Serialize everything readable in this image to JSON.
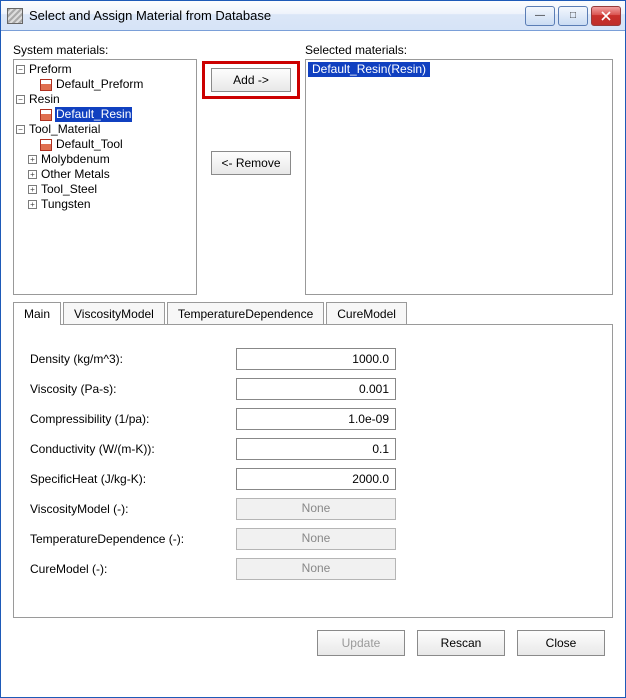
{
  "window": {
    "title": "Select and Assign Material from Database"
  },
  "labels": {
    "system_materials": "System materials:",
    "selected_materials": "Selected materials:",
    "add": "Add ->",
    "remove": "<- Remove",
    "update": "Update",
    "rescan": "Rescan",
    "close": "Close"
  },
  "tree": {
    "preform": "Preform",
    "default_preform": "Default_Preform",
    "resin": "Resin",
    "default_resin": "Default_Resin",
    "tool_material": "Tool_Material",
    "default_tool": "Default_Tool",
    "molybdenum": "Molybdenum",
    "other_metals": "Other Metals",
    "tool_steel": "Tool_Steel",
    "tungsten": "Tungsten"
  },
  "selected_list": {
    "item0": "Default_Resin(Resin)"
  },
  "tabs": {
    "main": "Main",
    "viscosity": "ViscosityModel",
    "tempdep": "TemperatureDependence",
    "curemodel": "CureModel"
  },
  "props": {
    "density_label": "Density (kg/m^3):",
    "density_value": "1000.0",
    "viscosity_label": "Viscosity (Pa-s):",
    "viscosity_value": "0.001",
    "compress_label": "Compressibility (1/pa):",
    "compress_value": "1.0e-09",
    "conduct_label": "Conductivity (W/(m-K)):",
    "conduct_value": "0.1",
    "specheat_label": "SpecificHeat (J/kg-K):",
    "specheat_value": "2000.0",
    "viscmodel_label": "ViscosityModel (-):",
    "viscmodel_value": "None",
    "tempdep_label": "TemperatureDependence (-):",
    "tempdep_value": "None",
    "curemodel_label": "CureModel (-):",
    "curemodel_value": "None"
  }
}
